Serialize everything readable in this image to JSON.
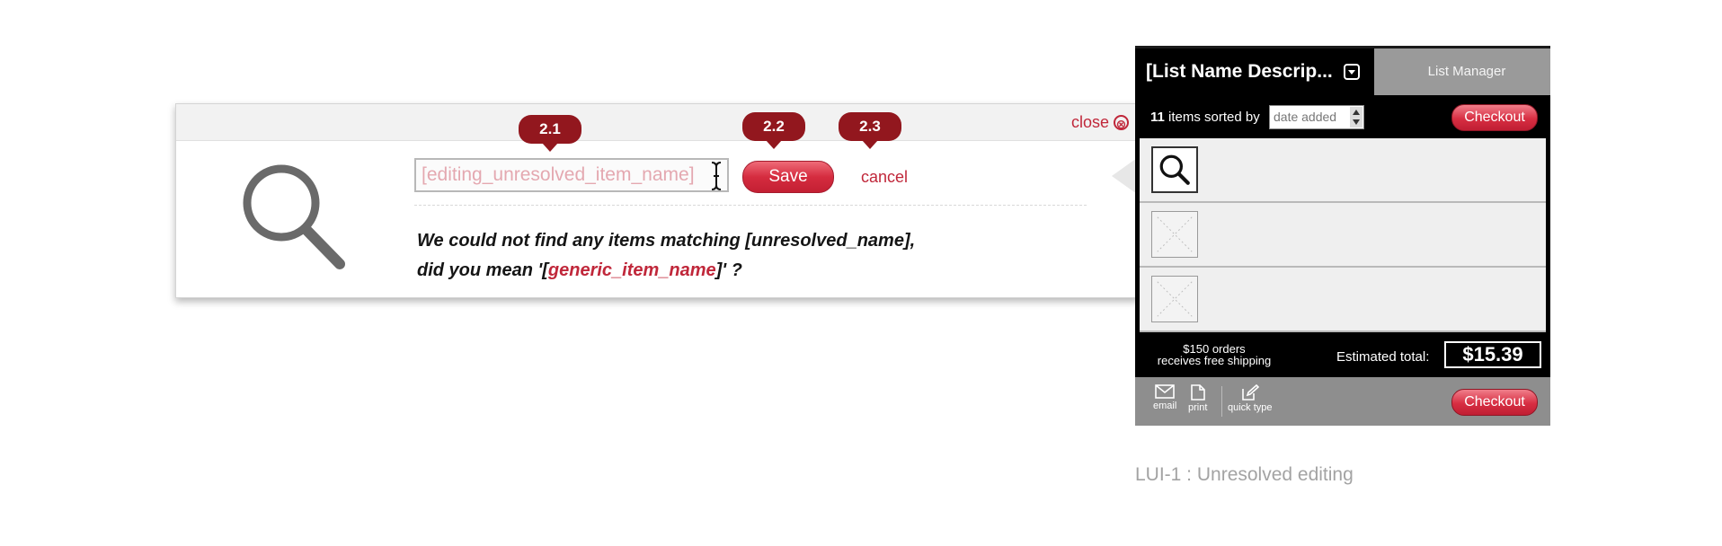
{
  "popup": {
    "close_label": "close",
    "close_icon_glyph": "⊗",
    "input_value": "[editing_unresolved_item_name]",
    "save_label": "Save",
    "cancel_label": "cancel",
    "message_line1": "We could not find any items matching [unresolved_name],",
    "message_line2_prefix": "did you mean '[",
    "message_line2_name": "generic_item_name",
    "message_line2_suffix": "]' ?",
    "accent_color": "#c0273a"
  },
  "callouts": [
    "2.1",
    "2.2",
    "2.3"
  ],
  "list_manager": {
    "list_title": "[List Name Descrip...",
    "manager_tab_label": "List Manager",
    "item_count": "11",
    "sorted_by_label": "items sorted by",
    "sort_value": "date added",
    "checkout_label": "Checkout",
    "items": [
      {
        "thumbnail": "search-icon"
      },
      {
        "thumbnail": "placeholder-image"
      },
      {
        "thumbnail": "placeholder-image"
      }
    ],
    "shipping_line1": "$150 orders",
    "shipping_line2": "receives free shipping",
    "estimated_label": "Estimated total:",
    "estimated_total": "$15.39",
    "tools": [
      {
        "label": "email",
        "icon": "envelope-icon"
      },
      {
        "label": "print",
        "icon": "document-icon"
      },
      {
        "label": "quick type",
        "icon": "edit-icon"
      }
    ]
  },
  "caption": "LUI-1 : Unresolved editing"
}
